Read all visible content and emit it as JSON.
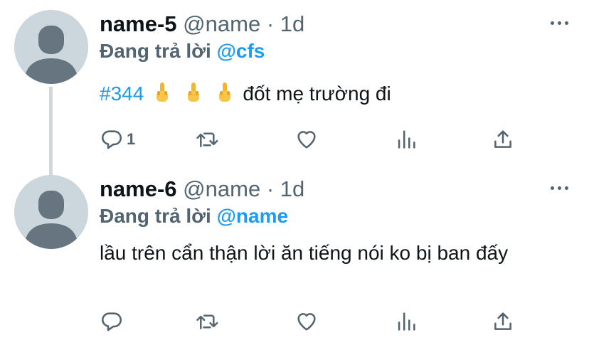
{
  "tweets": [
    {
      "name": "name-5",
      "handle": "@name",
      "dot": "·",
      "time": "1d",
      "replying_prefix": "Đang trả lời",
      "replying_to": "@cfs",
      "hashtag": "#344",
      "emoji_icons": [
        "middle-finger-emoji",
        "middle-finger-emoji",
        "middle-finger-emoji"
      ],
      "text": "đốt mẹ trường đi",
      "reply_count": "1"
    },
    {
      "name": "name-6",
      "handle": "@name",
      "dot": "·",
      "time": "1d",
      "replying_prefix": "Đang trả lời",
      "replying_to": "@name",
      "text": "lầu trên cẩn thận lời ăn tiếng nói ko bị ban đấy",
      "reply_count": ""
    }
  ],
  "icons": {
    "reply": "speech-bubble-icon",
    "retweet": "retweet-icon",
    "like": "heart-icon",
    "stats": "bar-chart-icon",
    "share": "share-upload-icon",
    "more": "more-dots-icon",
    "avatar": "default-avatar-icon"
  },
  "colors": {
    "accent": "#1d9bf0",
    "secondary_text": "#536471",
    "avatar_bg": "#ccd6dd",
    "avatar_fg": "#66757f"
  }
}
